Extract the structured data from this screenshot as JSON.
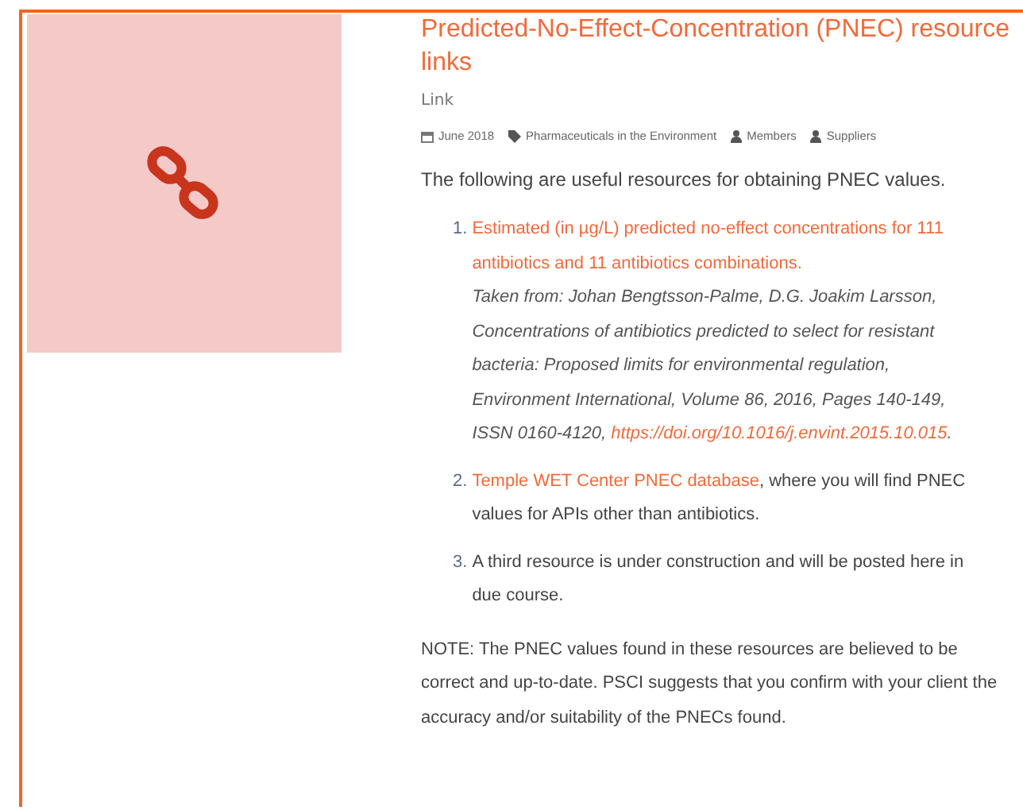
{
  "post": {
    "title": "Predicted-No-Effect-Concentration (PNEC) resource links",
    "format": "Link",
    "meta": [
      {
        "kind": "date",
        "text": "June 2018"
      },
      {
        "kind": "tag",
        "text": "Pharmaceuticals in the Environment"
      },
      {
        "kind": "user",
        "text": "Members"
      },
      {
        "kind": "user",
        "text": "Suppliers"
      }
    ],
    "intro": "The following are useful resources for obtaining PNEC values.",
    "resources": [
      {
        "number": "1.",
        "link": "Estimated (in µg/L) predicted no-effect concentrations for 111 antibiotics and 11 antibiotics combinations.",
        "citation": "Taken from: Johan Bengtsson-Palme, D.G. Joakim Larsson, Concentrations of antibiotics predicted to select for resistant bacteria: Proposed limits for environmental regulation, Environment International, Volume 86, 2016, Pages 140-149, ISSN 0160-4120,",
        "citation_link": "https://doi.org/10.1016/j.envint.2015.10.015",
        "citation_end": "."
      },
      {
        "number": "2.",
        "link": "Temple WET Center PNEC database",
        "rest": ", where you will find PNEC values for APIs other than antibiotics."
      },
      {
        "number": "3.",
        "rest": "A third resource is under construction and will be posted here in due course."
      }
    ],
    "note": "NOTE: The PNEC values found in these resources are believed to be correct and up-to-date. PSCI suggests that you confirm with your client the accuracy and/or suitability of the PNECs found."
  }
}
